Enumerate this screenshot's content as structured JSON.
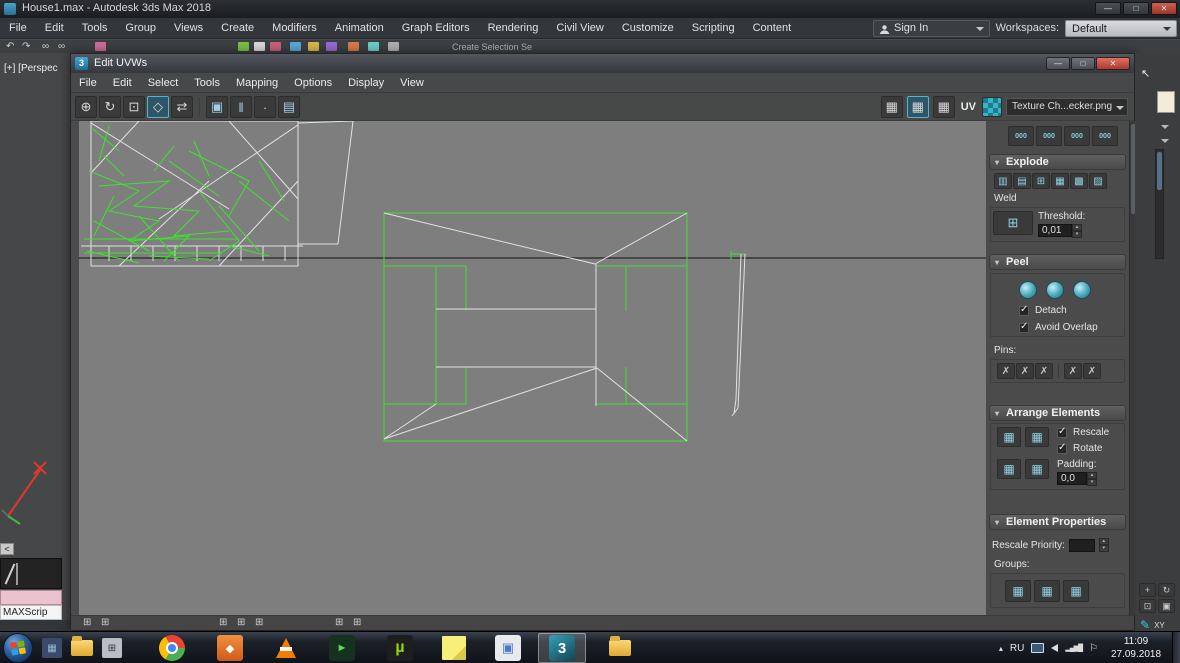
{
  "colors": {
    "uv_wire_green": "#3fe22f",
    "uv_wire_white": "#e2e2e2",
    "canvas_gray": "#7e7e7e",
    "accent_teal": "#7fd0e0",
    "close_red": "#b03a2c"
  },
  "main_window": {
    "title": "House1.max - Autodesk 3ds Max 2018",
    "menu_items": [
      "File",
      "Edit",
      "Tools",
      "Group",
      "Views",
      "Create",
      "Modifiers",
      "Animation",
      "Graph Editors",
      "Rendering",
      "Civil View",
      "Customize",
      "Scripting",
      "Content"
    ],
    "sign_in_label": "Sign In",
    "workspaces_label": "Workspaces:",
    "workspace_value": "Default",
    "selection_set_field": "Create Selection Se"
  },
  "viewport": {
    "label": "[+] [Perspec",
    "back_button": "<",
    "maxscript_label": "MAXScrip"
  },
  "dialog": {
    "title": "Edit UVWs",
    "menu_items": [
      "File",
      "Edit",
      "Select",
      "Tools",
      "Mapping",
      "Options",
      "Display",
      "View"
    ],
    "uv_label": "UV",
    "texture_value": "Texture Ch...ecker.png",
    "panel": {
      "explode_title": "Explode",
      "weld_label": "Weld",
      "threshold_label": "Threshold:",
      "threshold_value": "0,01",
      "peel_title": "Peel",
      "detach_label": "Detach",
      "avoid_overlap_label": "Avoid Overlap",
      "pins_label": "Pins:",
      "arrange_title": "Arrange Elements",
      "rescale_label": "Rescale",
      "rotate_label": "Rotate",
      "padding_label": "Padding:",
      "padding_value": "0,0",
      "element_properties_title": "Element Properties",
      "rescale_priority_label": "Rescale Priority:",
      "groups_label": "Groups:"
    }
  },
  "right_edge": {
    "coords_label": "XY"
  },
  "taskbar": {
    "language": "RU",
    "time": "11:09",
    "date": "27.09.2018",
    "quick_items": [
      {
        "name": "pinned-app",
        "glyph": "▦"
      },
      {
        "name": "explorer",
        "glyph": ""
      },
      {
        "name": "calculator",
        "glyph": "⊞"
      }
    ],
    "items": [
      {
        "name": "chrome",
        "glyph": ""
      },
      {
        "name": "orange-app",
        "glyph": "◆"
      },
      {
        "name": "vlc",
        "glyph": ""
      },
      {
        "name": "media-app",
        "glyph": "►"
      },
      {
        "name": "utorrent",
        "glyph": "µ"
      },
      {
        "name": "sticky-notes",
        "glyph": ""
      },
      {
        "name": "image-viewer",
        "glyph": "▣"
      },
      {
        "name": "3ds-max",
        "glyph": "3"
      },
      {
        "name": "explorer-window",
        "glyph": ""
      }
    ]
  },
  "icons": {
    "dialog_badge": "3",
    "undo": "↶",
    "redo": "↷",
    "link": "∞",
    "move": "⊕",
    "rotate": "↻",
    "scale": "⊡",
    "freeform": "◇",
    "mirror": "⇄",
    "sel_element": "▣",
    "sel_edge": "‖",
    "sel_vertex": "·",
    "sel_face": "▤",
    "grid": "▦",
    "pack": "000",
    "explode_1": "▥",
    "explode_2": "▤",
    "explode_3": "⊞",
    "explode_4": "▦",
    "explode_5": "▩",
    "explode_6": "▨",
    "weld_target": "⊞",
    "pin": "✗",
    "status_snap": "⊞",
    "nav_pan": "+",
    "nav_orbit": "↻",
    "nav_zoom": "⊡",
    "nav_max": "▣",
    "pencil": "✎",
    "cursor": "↖",
    "tray_arrow": "▴",
    "tray_flag": "⚐",
    "tray_net": "▂▄▆█"
  }
}
